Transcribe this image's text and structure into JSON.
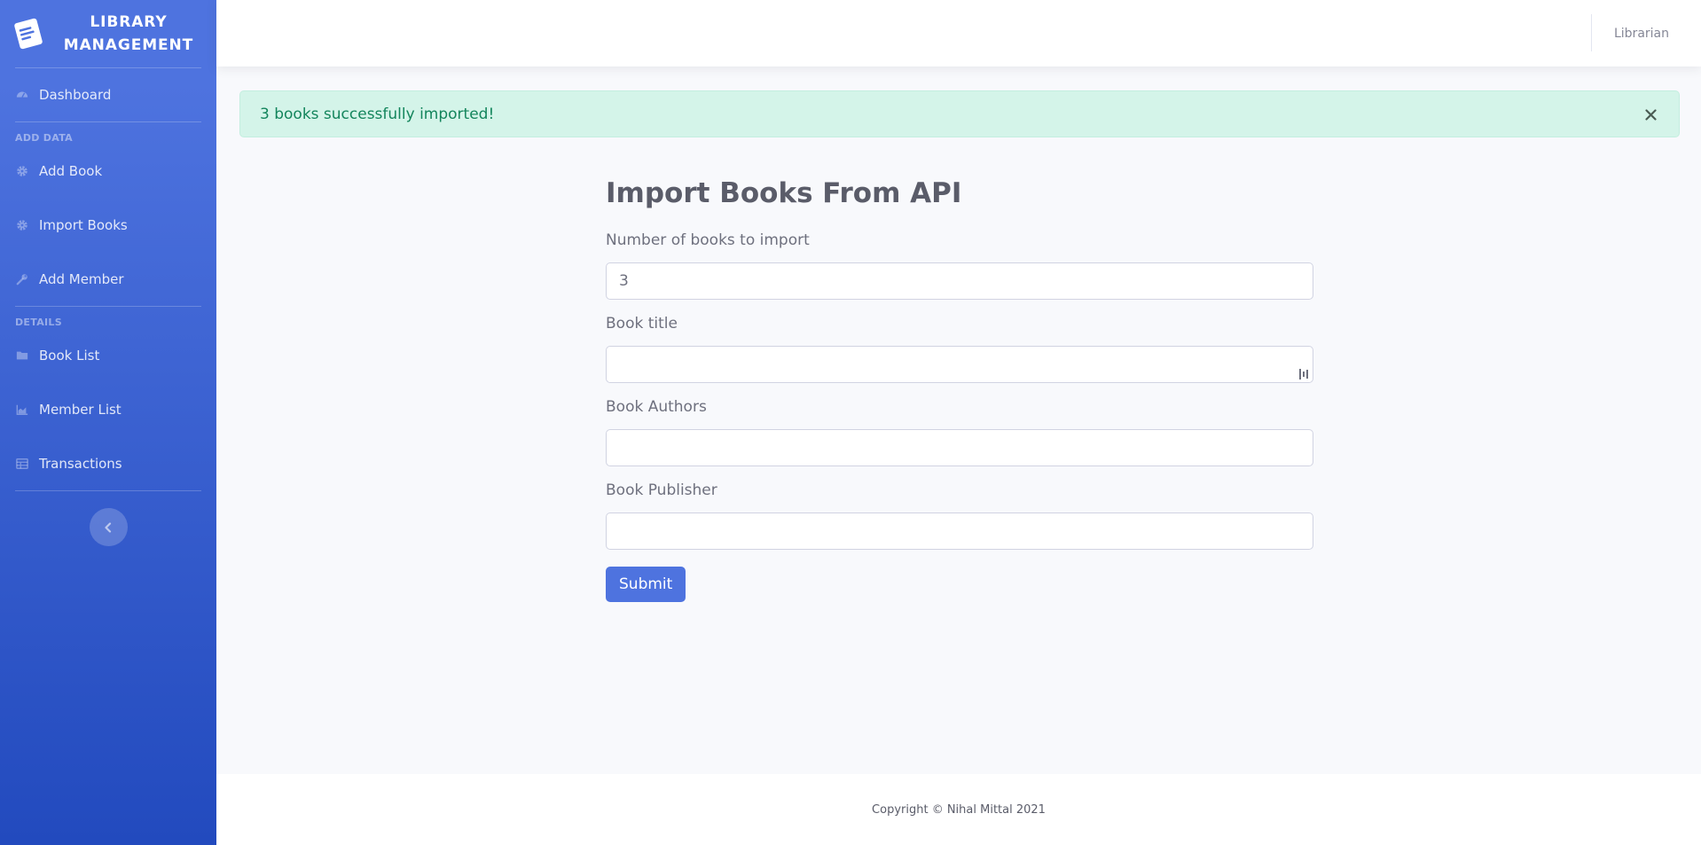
{
  "sidebar": {
    "brand": {
      "line1": "LIBRARY",
      "line2": "MANAGEMENT"
    },
    "dashboard": {
      "label": "Dashboard",
      "icon": "tachometer-icon"
    },
    "heading_add": "ADD DATA",
    "add_book": {
      "label": "Add Book",
      "icon": "cog-icon"
    },
    "import_books": {
      "label": "Import Books",
      "icon": "cog-icon"
    },
    "add_member": {
      "label": "Add Member",
      "icon": "wrench-icon"
    },
    "heading_details": "DETAILS",
    "book_list": {
      "label": "Book List",
      "icon": "folder-icon"
    },
    "member_list": {
      "label": "Member List",
      "icon": "chart-area-icon"
    },
    "transactions": {
      "label": "Transactions",
      "icon": "table-icon"
    }
  },
  "topbar": {
    "user": "Librarian"
  },
  "alert": {
    "message": "3 books successfully imported!"
  },
  "form": {
    "title": "Import Books From API",
    "num_books": {
      "label": "Number of books to import",
      "value": "3"
    },
    "book_title": {
      "label": "Book title",
      "value": ""
    },
    "book_authors": {
      "label": "Book Authors",
      "value": ""
    },
    "book_publisher": {
      "label": "Book Publisher",
      "value": ""
    },
    "submit_label": "Submit"
  },
  "footer": {
    "copyright": "Copyright © Nihal Mittal 2021"
  },
  "colors": {
    "primary": "#4e73df",
    "sidebar_gradient_end": "#224abe",
    "alert_bg": "#d4f4e9",
    "alert_text": "#13855c"
  }
}
